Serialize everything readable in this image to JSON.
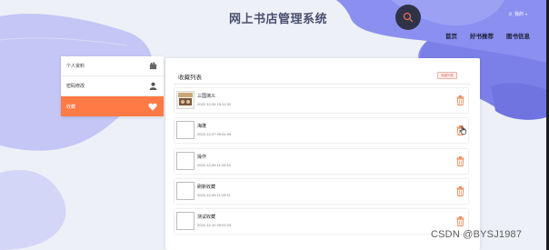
{
  "header": {
    "site_title": "网上书店管理系统",
    "user_label": "我的",
    "nav": [
      "首页",
      "好书推荐",
      "图书信息"
    ]
  },
  "sidebar": {
    "items": [
      {
        "label": "个人资料",
        "icon": "id-card-icon",
        "active": false
      },
      {
        "label": "密码修改",
        "icon": "user-icon",
        "active": false
      },
      {
        "label": "收藏",
        "icon": "heart-icon",
        "active": true
      }
    ]
  },
  "panel": {
    "title": "收藏列表",
    "tag_label": "收藏列表"
  },
  "favorites": [
    {
      "name": "三国演义",
      "time": "2022-12-04 15:11:30",
      "has_cover": true
    },
    {
      "name": "海蓬",
      "time": "2022-12-07 09:01:09",
      "has_cover": false
    },
    {
      "name": "操作",
      "time": "2022-12-09 11:10:10",
      "has_cover": false
    },
    {
      "name": "刷新收藏",
      "time": "2022-12-09 11:19:11",
      "has_cover": false
    },
    {
      "name": "测试收藏",
      "time": "2022-12-10 09:02:24",
      "has_cover": false
    }
  ],
  "watermark": "CSDN @BYSJ1987",
  "colors": {
    "accent": "#ff7a45",
    "blob": "#8a8ff0",
    "delete": "#ef8a5a",
    "dark_button": "#2f3347"
  }
}
